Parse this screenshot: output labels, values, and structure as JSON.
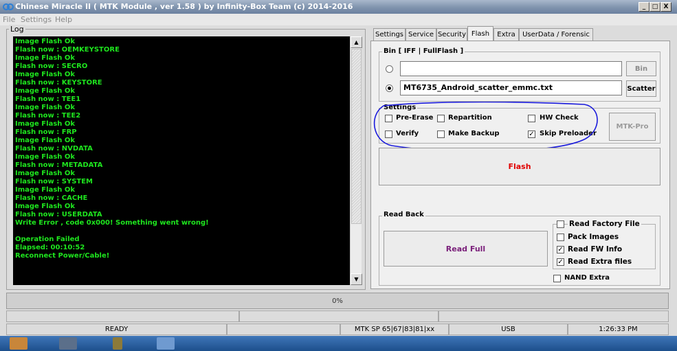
{
  "window": {
    "title": "Chinese Miracle II ( MTK Module , ver 1.58 ) by Infinity-Box Team (c) 2014-2016",
    "minimize_label": "_",
    "maximize_label": "□",
    "close_label": "X"
  },
  "menu": [
    "File",
    "Settings",
    "Help"
  ],
  "log": {
    "label": "Log",
    "lines": [
      "Image Flash Ok",
      "Flash now : OEMKEYSTORE",
      "Image Flash Ok",
      "Flash now : SECRO",
      "Image Flash Ok",
      "Flash now : KEYSTORE",
      "Image Flash Ok",
      "Flash now : TEE1",
      "Image Flash Ok",
      "Flash now : TEE2",
      "Image Flash Ok",
      "Flash now : FRP",
      "Image Flash Ok",
      "Flash now : NVDATA",
      "Image Flash Ok",
      "Flash now : METADATA",
      "Image Flash Ok",
      "Flash now : SYSTEM",
      "Image Flash Ok",
      "Flash now : CACHE",
      "Image Flash Ok",
      "Flash now : USERDATA",
      "Write Error , code 0x000! Something went wrong!",
      "",
      "Operation Failed",
      "Elapsed: 00:10:52",
      "Reconnect Power/Cable!"
    ]
  },
  "tabs": [
    "Settings",
    "Service",
    "Security",
    "Flash",
    "Extra",
    "UserData / Forensic"
  ],
  "active_tab": "Flash",
  "bin": {
    "title": "Bin  [ IFF | FullFlash ]",
    "file_value": "",
    "scatter_value": "MT6735_Android_scatter_emmc.txt",
    "bin_button": "Bin",
    "scatter_button": "Scatter"
  },
  "settings": {
    "title": "Settings",
    "pre_erase": "Pre-Erase",
    "repartition": "Repartition",
    "hw_check": "HW Check",
    "verify": "Verify",
    "make_backup": "Make Backup",
    "skip_preloader": "Skip Preloader",
    "mtk_pro_button": "MTK-Pro",
    "check_mark": "✓"
  },
  "flash_button": "Flash",
  "read_back": {
    "title": "Read Back",
    "read_full_button": "Read Full",
    "read_factory_file": "Read Factory File",
    "pack_images": "Pack Images",
    "read_fw_info": "Read FW Info",
    "read_extra_files": "Read Extra files",
    "nand_extra": "NAND Extra"
  },
  "progress_text": "0%",
  "status": {
    "state": "READY",
    "chip": "MTK SP 65|67|83|81|xx",
    "port": "USB",
    "time": "1:26:33 PM"
  },
  "colors": {
    "log_text": "#1ee61e",
    "flash_button_text": "#e00000",
    "read_full_text": "#7a1f7a",
    "annotation_circle": "#1a1adc"
  }
}
